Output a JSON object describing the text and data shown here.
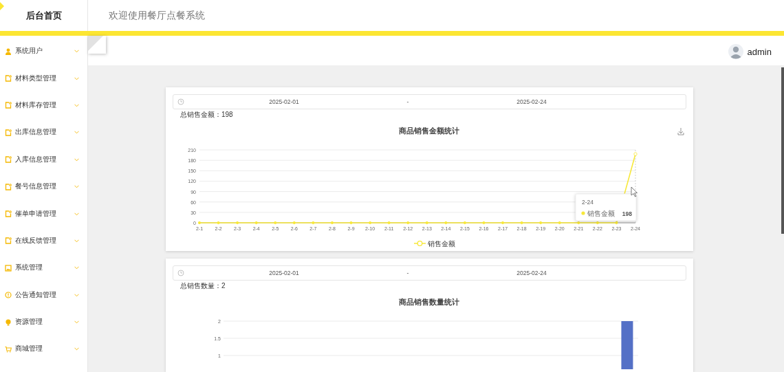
{
  "sidebar": {
    "brand": "后台首页",
    "items": [
      {
        "label": "系统用户",
        "expanded": false
      },
      {
        "label": "材料类型管理",
        "expanded": false
      },
      {
        "label": "材料库存管理",
        "expanded": false
      },
      {
        "label": "出库信息管理",
        "expanded": false
      },
      {
        "label": "入库信息管理",
        "expanded": false
      },
      {
        "label": "餐号信息管理",
        "expanded": false
      },
      {
        "label": "催单申请管理",
        "expanded": false
      },
      {
        "label": "在线反馈管理",
        "expanded": false
      },
      {
        "label": "系统管理",
        "expanded": false
      },
      {
        "label": "公告通知管理",
        "expanded": false
      },
      {
        "label": "资源管理",
        "expanded": false
      },
      {
        "label": "商城管理",
        "expanded": false
      }
    ]
  },
  "header": {
    "title": "欢迎使用餐厅点餐系统"
  },
  "user": {
    "name": "admin"
  },
  "panels": [
    {
      "date_range": {
        "start": "2025-02-01",
        "separator": "-",
        "end": "2025-02-24"
      },
      "summary": "总销售金额：198",
      "chart_data": {
        "type": "line",
        "title": "商品销售金额统计",
        "categories": [
          "2-1",
          "2-2",
          "2-3",
          "2-4",
          "2-5",
          "2-6",
          "2-7",
          "2-8",
          "2-9",
          "2-10",
          "2-11",
          "2-12",
          "2-13",
          "2-14",
          "2-15",
          "2-16",
          "2-17",
          "2-18",
          "2-19",
          "2-20",
          "2-21",
          "2-22",
          "2-23",
          "2-24"
        ],
        "series": [
          {
            "name": "销售金额",
            "color": "#f7e83a",
            "marker": true,
            "values": [
              0,
              0,
              0,
              0,
              0,
              0,
              0,
              0,
              0,
              0,
              0,
              0,
              0,
              0,
              0,
              0,
              0,
              0,
              0,
              0,
              0,
              0,
              0,
              198
            ]
          }
        ],
        "grid": true,
        "ylim": [
          0,
          210
        ],
        "yticks": [
          0,
          30,
          60,
          90,
          120,
          150,
          180,
          210
        ]
      },
      "tooltip": {
        "title": "2-24",
        "series": "销售金额",
        "value": "198"
      }
    },
    {
      "date_range": {
        "start": "2025-02-01",
        "separator": "-",
        "end": "2025-02-24"
      },
      "summary": "总销售数量：2",
      "chart_data": {
        "type": "bar",
        "title": "商品销售数量统计",
        "series": [
          {
            "color": "#5470c6",
            "values": [
              0,
              0,
              0,
              0,
              0,
              0,
              0,
              0,
              0,
              0,
              0,
              0,
              0,
              0,
              0,
              0,
              0,
              0,
              0,
              0,
              0,
              0,
              0,
              2
            ]
          }
        ],
        "grid": true,
        "ylim": [
          0,
          2
        ],
        "yticks": [
          1,
          1.5,
          2
        ]
      }
    }
  ]
}
